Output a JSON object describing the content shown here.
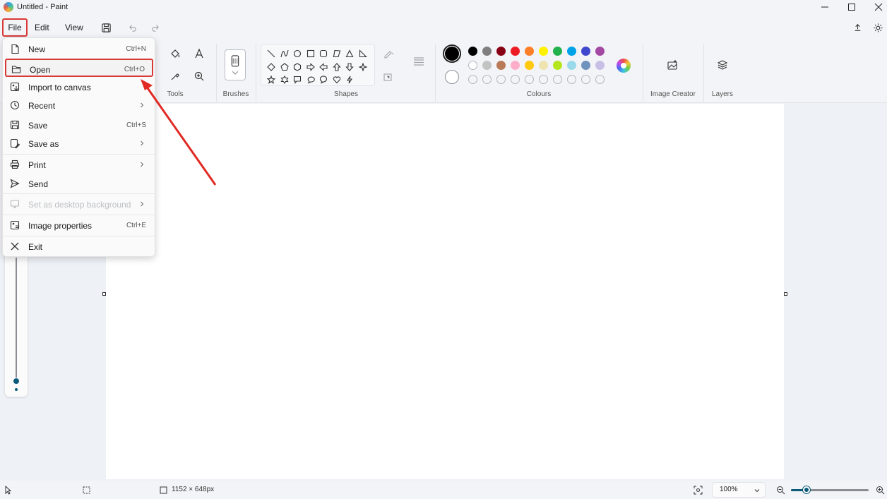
{
  "window": {
    "title": "Untitled - Paint",
    "app_icon": "paint-app-icon",
    "controls": [
      "minimize-icon",
      "maximize-icon",
      "close-icon"
    ]
  },
  "menubar": {
    "file": "File",
    "edit": "Edit",
    "view": "View",
    "icons": [
      "save-icon",
      "undo-icon",
      "redo-icon",
      "share-icon",
      "settings-icon"
    ]
  },
  "ribbon": {
    "tools_label": "Tools",
    "brushes_label": "Brushes",
    "shapes_label": "Shapes",
    "colours_label": "Colours",
    "image_creator_label": "Image Creator",
    "layers_label": "Layers"
  },
  "colors": {
    "primary": "#000000",
    "secondary": "#ffffff",
    "row1": [
      "#000000",
      "#7f7f7f",
      "#880015",
      "#ed1c24",
      "#ff7f27",
      "#fff200",
      "#22b14c",
      "#00a2e8",
      "#3f48cc",
      "#a349a4"
    ],
    "row2": [
      "#ffffff",
      "#c3c3c3",
      "#b97a57",
      "#ffaec9",
      "#ffc90e",
      "#efe4b0",
      "#b5e61d",
      "#99d9ea",
      "#7092be",
      "#c8bfe7"
    ],
    "row3_empty_count": 10,
    "highlight": "#d83a35",
    "accent": "#0b5a7a"
  },
  "file_menu": {
    "items": [
      {
        "label": "New",
        "shortcut": "Ctrl+N",
        "icon": "new-file-icon"
      },
      {
        "label": "Open",
        "shortcut": "Ctrl+O",
        "icon": "open-folder-icon"
      },
      {
        "label": "Import to canvas",
        "shortcut": "",
        "icon": "import-icon"
      },
      {
        "label": "Recent",
        "shortcut": "",
        "icon": "recent-clock-icon"
      },
      {
        "label": "Save",
        "shortcut": "Ctrl+S",
        "icon": "save-icon"
      },
      {
        "label": "Save as",
        "shortcut": "",
        "icon": "save-as-icon"
      },
      {
        "label": "Print",
        "shortcut": "",
        "icon": "print-icon"
      },
      {
        "label": "Send",
        "shortcut": "",
        "icon": "send-icon"
      },
      {
        "label": "Set as desktop background",
        "shortcut": "",
        "icon": "desktop-background-icon"
      },
      {
        "label": "Image properties",
        "shortcut": "Ctrl+E",
        "icon": "image-properties-icon"
      },
      {
        "label": "Exit",
        "shortcut": "",
        "icon": "exit-x-icon"
      }
    ]
  },
  "status": {
    "canvas_size": "1152 × 648px",
    "zoom": "100%",
    "zoom_fraction": 0.2
  }
}
